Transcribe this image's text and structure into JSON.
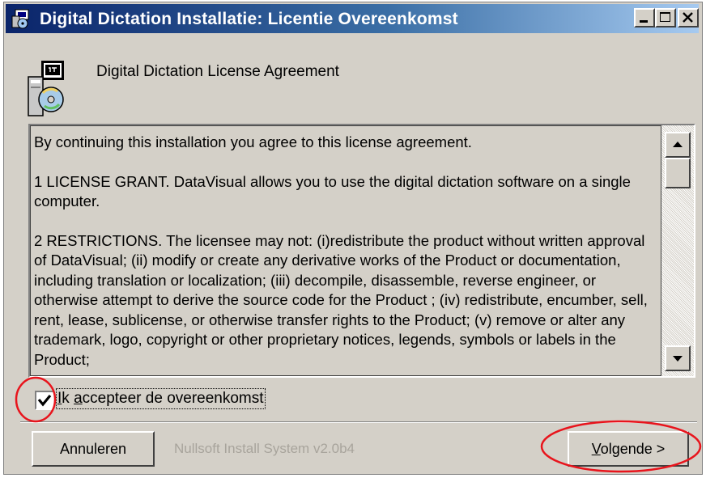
{
  "window": {
    "title": "Digital Dictation Installatie: Licentie Overeenkomst",
    "controls": [
      "minimize",
      "maximize",
      "close"
    ]
  },
  "header": {
    "title": "Digital Dictation License Agreement",
    "icon": "installer-icon"
  },
  "license": {
    "paragraphs": [
      "By  continuing this installation you agree to this license agreement.",
      "1 LICENSE GRANT. DataVisual allows you to use the digital dictation software on a single computer.",
      "2 RESTRICTIONS. The licensee may not: (i)redistribute the product without written approval of DataVisual; (ii)  modify or create any derivative works of the Product or documentation, including translation or localization; (iii) decompile, disassemble, reverse engineer, or otherwise attempt to derive the source code for the Product ; (iv) redistribute, encumber, sell, rent, lease, sublicense, or otherwise transfer rights to the Product; (v) remove or alter any trademark, logo, copyright or other proprietary notices, legends, symbols or labels in the Product;"
    ]
  },
  "accept": {
    "label_access_key": "I",
    "label_mid": "k ",
    "label_access_key2": "a",
    "label_rest": "ccepteer de overeenkomst",
    "checked": true
  },
  "footer": {
    "cancel_label": "Annuleren",
    "branding": "Nullsoft Install System v2.0b4",
    "next_access_key": "V",
    "next_label_rest": "olgende >"
  },
  "annotations": {
    "color": "#e8141c"
  }
}
